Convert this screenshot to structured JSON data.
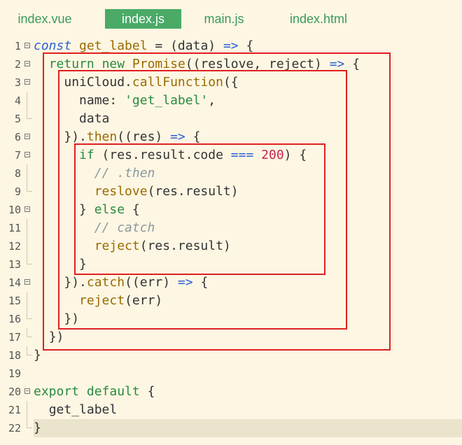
{
  "tabs": [
    {
      "label": "index.vue",
      "active": false
    },
    {
      "label": "index.js",
      "active": true
    },
    {
      "label": "main.js",
      "active": false
    },
    {
      "label": "index.html",
      "active": false
    }
  ],
  "line_numbers": [
    "1",
    "2",
    "3",
    "4",
    "5",
    "6",
    "7",
    "8",
    "9",
    "10",
    "11",
    "12",
    "13",
    "14",
    "15",
    "16",
    "17",
    "18",
    "19",
    "20",
    "21",
    "22"
  ],
  "code": {
    "l1": {
      "kw": "const",
      "name": "get_label",
      "eq": " = ",
      "rest": "(data) ",
      "arrow": "=>",
      "brace": " {"
    },
    "l2": {
      "ret": "return",
      "new": "new",
      "promise": "Promise",
      "args": "((reslove, reject) ",
      "arrow": "=>",
      "brace": " {"
    },
    "l3": {
      "obj": "uniCloud.",
      "fn": "callFunction",
      "rest": "({"
    },
    "l4": {
      "key": "name: ",
      "str": "'get_label'",
      "comma": ","
    },
    "l5": {
      "text": "data"
    },
    "l6": {
      "pre": "}).",
      "fn": "then",
      "args": "((res) ",
      "arrow": "=>",
      "brace": " {"
    },
    "l7": {
      "kw": "if",
      "cond": " (res.result.code ",
      "op": "===",
      "num": "200",
      "rest": ") {"
    },
    "l8": {
      "comment": "// .then"
    },
    "l9": {
      "fn": "reslove",
      "args": "(res.result)"
    },
    "l10": {
      "pre": "} ",
      "kw": "else",
      "brace": " {"
    },
    "l11": {
      "comment": "// catch"
    },
    "l12": {
      "fn": "reject",
      "args": "(res.result)"
    },
    "l13": {
      "text": "}"
    },
    "l14": {
      "pre": "}).",
      "fn": "catch",
      "args": "((err) ",
      "arrow": "=>",
      "brace": " {"
    },
    "l15": {
      "fn": "reject",
      "args": "(err)"
    },
    "l16": {
      "text": "})"
    },
    "l17": {
      "text": "})"
    },
    "l18": {
      "text": "}"
    },
    "l19": {
      "text": ""
    },
    "l20": {
      "kw1": "export",
      "kw2": "default",
      "brace": " {"
    },
    "l21": {
      "text": "get_label"
    },
    "l22": {
      "text": "}"
    }
  },
  "colors": {
    "highlight_box": "#e02020",
    "background": "#fdf6e3",
    "active_tab": "#4aaa66"
  }
}
